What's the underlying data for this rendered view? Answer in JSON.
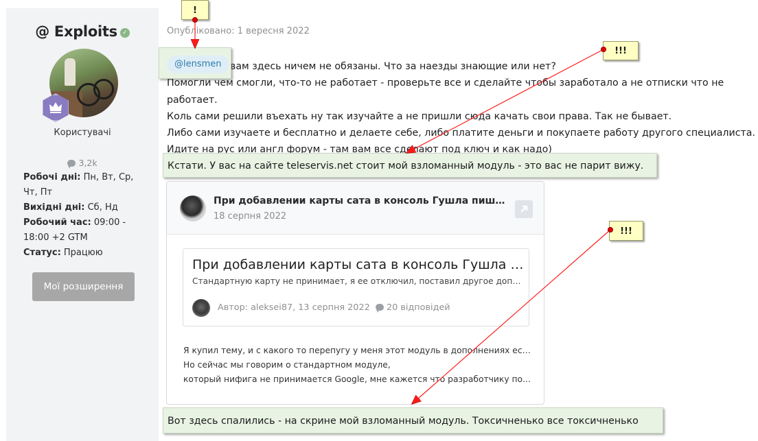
{
  "author": {
    "name": "@ Exploits",
    "role": "Користувачі",
    "message_count": "3,2k",
    "info": [
      {
        "label": "Робочі дні:",
        "value": "Пн, Вт, Ср, Чт, Пт"
      },
      {
        "label": "Вихідні дні:",
        "value": "Сб, Нд"
      },
      {
        "label": "Робочий час:",
        "value": "09:00 - 18:00 +2 GTM"
      },
      {
        "label": "Статус:",
        "value": "Працюю"
      }
    ],
    "extensions_button": "Мої розширення"
  },
  "post": {
    "published": "Опубліковано: 1 вересня 2022",
    "mention": "@lensmen",
    "lines": [
      "вам здесь ничем не обязаны. Что за наезды знающие или нет?",
      "Помогли чем смогли, что-то не работает - проверьте все и сделайте чтобы заработало а не отписки что не работает.",
      "Коль сами решили въехать ну так изучайте а не пришли сюда качать свои права. Так не бывает.",
      "Либо сами изучаете и бесплатно и делаете себе, либо платите деньги и покупаете работу другого специалиста.",
      "Идите на рус или англ форум - там вам все сделают под ключ и как надо)"
    ]
  },
  "quote": {
    "title": "При добавлении карты сата в консоль Гушла пишет \"Не ...",
    "date": "18 серпня 2022",
    "topic": {
      "title": "При добавлении карты сата в консоль Гушла пише...",
      "description": "Стандартную карту не принимает, я ее отключил, поставил другое допо...",
      "author": "Автор: aleksei87, 13 серпня 2022",
      "replies": "20 відповідей"
    },
    "text": [
      "Я купил тему, и с какого то перепугу у меня этот модуль в дополнениях есть.",
      "Но сейчас мы говорим о стандартном модуле,",
      "который нифига не принимается Google, мне кажется что разработчику по..."
    ]
  },
  "annotations": {
    "note_top": "",
    "note_mid": "Кстати. У вас на сайте teleservis.net стоит мой взломанный модуль - это вас не парит вижу.",
    "note_bottom": "Вот здесь спалились - на скрине мой взломанный модуль. Токсичненько все токсичненько панове",
    "sticky_1": "!",
    "sticky_2": "!!!",
    "sticky_3": "!!!",
    "arrow_color": "#e00000",
    "sticky_color": "#ffffc4",
    "note_color": "#e8f3e4"
  }
}
